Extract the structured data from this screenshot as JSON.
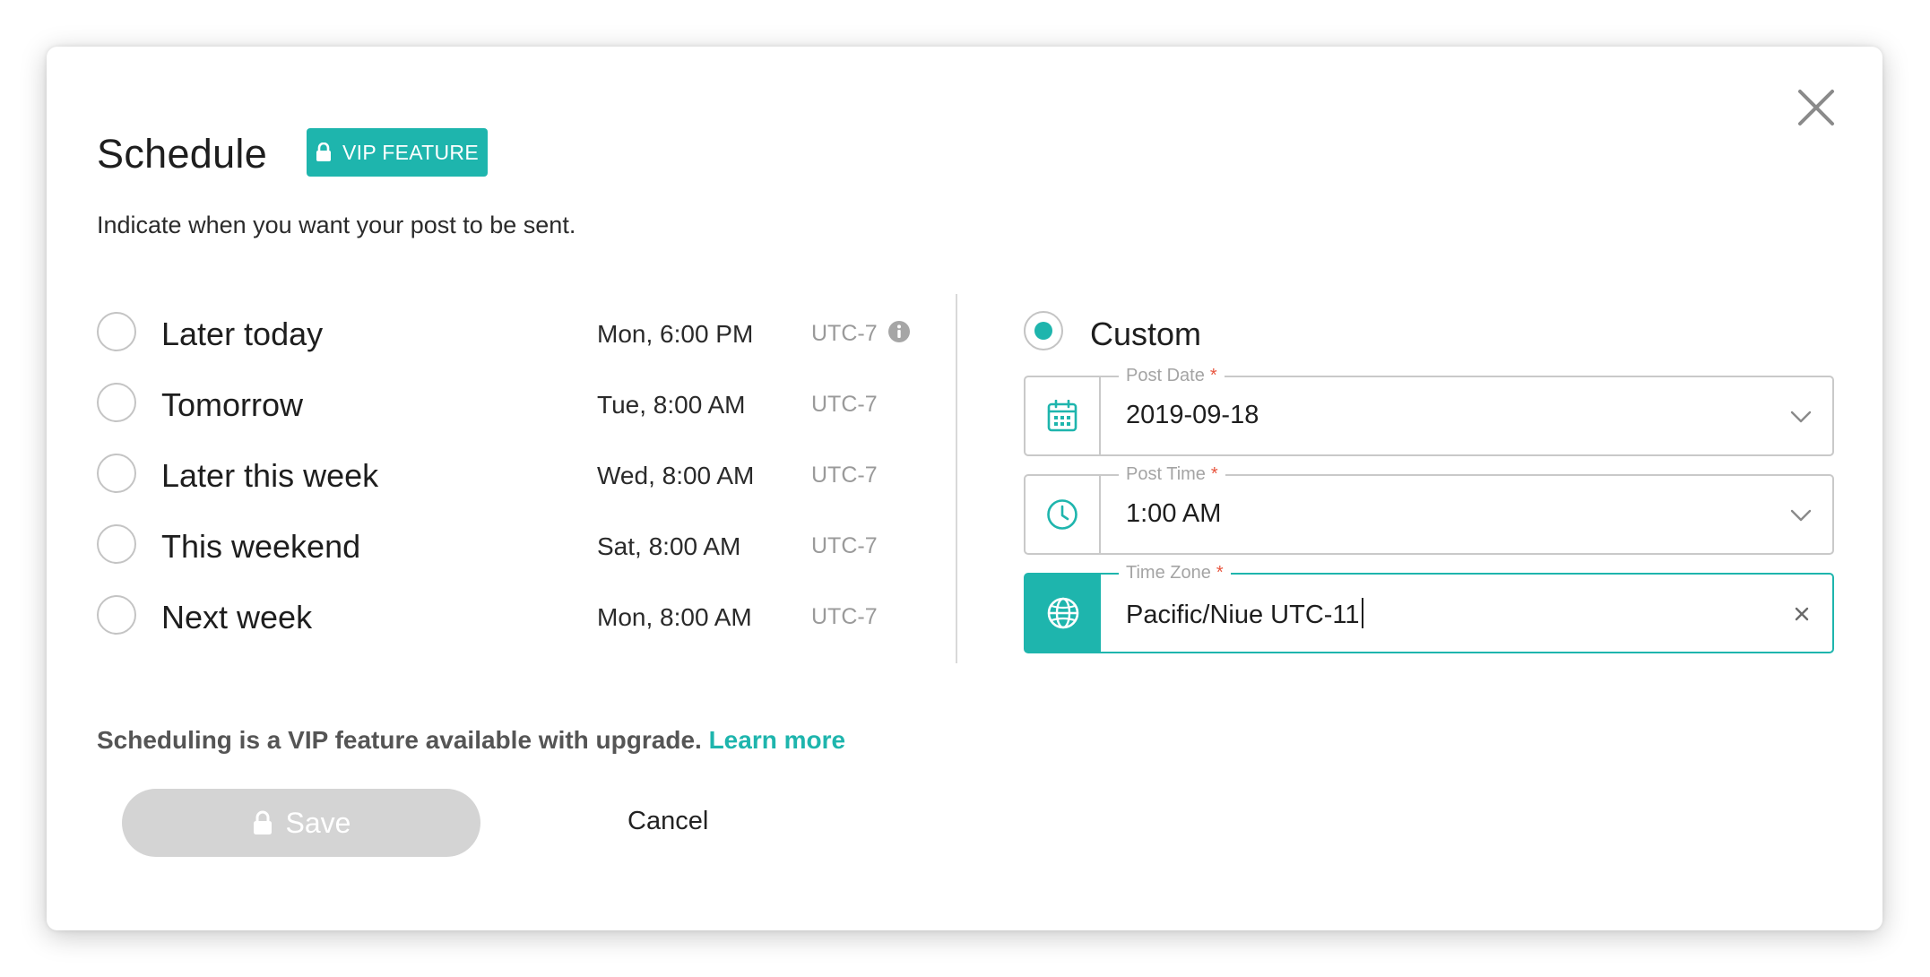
{
  "dialog": {
    "title": "Schedule",
    "vip_badge": "VIP FEATURE",
    "subtitle": "Indicate when you want your post to be sent."
  },
  "options": [
    {
      "label": "Later today",
      "time": "Mon, 6:00 PM",
      "tz": "UTC-7",
      "selected": false,
      "info": true
    },
    {
      "label": "Tomorrow",
      "time": "Tue, 8:00 AM",
      "tz": "UTC-7",
      "selected": false
    },
    {
      "label": "Later this week",
      "time": "Wed, 8:00 AM",
      "tz": "UTC-7",
      "selected": false
    },
    {
      "label": "This weekend",
      "time": "Sat, 8:00 AM",
      "tz": "UTC-7",
      "selected": false
    },
    {
      "label": "Next week",
      "time": "Mon, 8:00 AM",
      "tz": "UTC-7",
      "selected": false
    }
  ],
  "custom": {
    "label": "Custom",
    "selected": true,
    "post_date": {
      "label": "Post Date",
      "required_mark": "*",
      "value": "2019-09-18",
      "icon": "calendar-icon"
    },
    "post_time": {
      "label": "Post Time",
      "required_mark": "*",
      "value": "1:00 AM",
      "icon": "clock-icon"
    },
    "time_zone": {
      "label": "Time Zone",
      "required_mark": "*",
      "value": "Pacific/Niue UTC-11",
      "icon": "globe-icon"
    }
  },
  "footer": {
    "notice": "Scheduling is a VIP feature available with upgrade.",
    "learn_more": "Learn more",
    "save_label": "Save",
    "cancel_label": "Cancel"
  },
  "colors": {
    "accent": "#1eb5ad",
    "disabled_button": "#d4d4d4",
    "required": "#e8553e"
  }
}
